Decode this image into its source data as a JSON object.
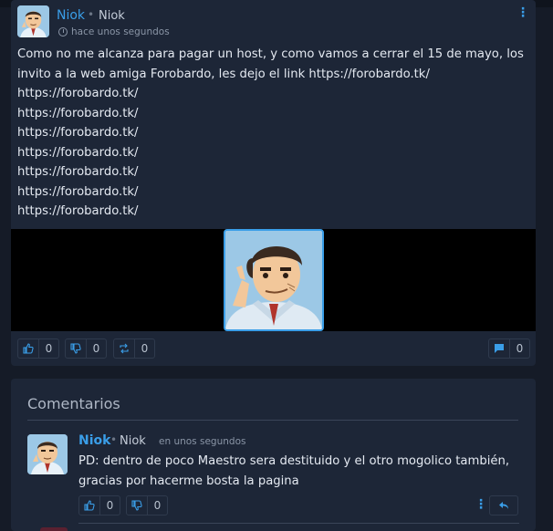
{
  "colors": {
    "accent": "#3a9ee8",
    "bg": "#151b27",
    "card": "#1d2637"
  },
  "post": {
    "author_name": "Niok",
    "separator": "•",
    "author_handle": "Niok",
    "time": "hace unos segundos",
    "icons": {
      "menu": "kebab-icon",
      "time": "clock-icon"
    },
    "lines": [
      "Como no me alcanza para pagar un host, y como vamos a cerrar el 15 de mayo, los invito a la web amiga Forobardo, les dejo el link https://forobardo.tk/",
      "https://forobardo.tk/",
      "https://forobardo.tk/",
      "https://forobardo.tk/",
      "https://forobardo.tk/",
      "https://forobardo.tk/",
      "https://forobardo.tk/",
      "https://forobardo.tk/"
    ],
    "actions": {
      "like_count": "0",
      "dislike_count": "0",
      "share_count": "0",
      "comment_count": "0",
      "icons": {
        "like": "thumbs-up-icon",
        "dislike": "thumbs-down-icon",
        "share": "repost-icon",
        "comment": "comment-icon"
      }
    }
  },
  "comments": {
    "title": "Comentarios",
    "items": [
      {
        "author_name": "Niok",
        "separator": "•",
        "author_handle": "Niok",
        "time": "en unos segundos",
        "text": "PD: dentro de poco Maestro sera destituido y el otro mogolico también, gracias por hacerme bosta la pagina",
        "like_count": "0",
        "dislike_count": "0",
        "icons": {
          "like": "thumbs-up-icon",
          "dislike": "thumbs-down-icon",
          "menu": "kebab-icon",
          "reply": "reply-icon"
        }
      }
    ]
  }
}
